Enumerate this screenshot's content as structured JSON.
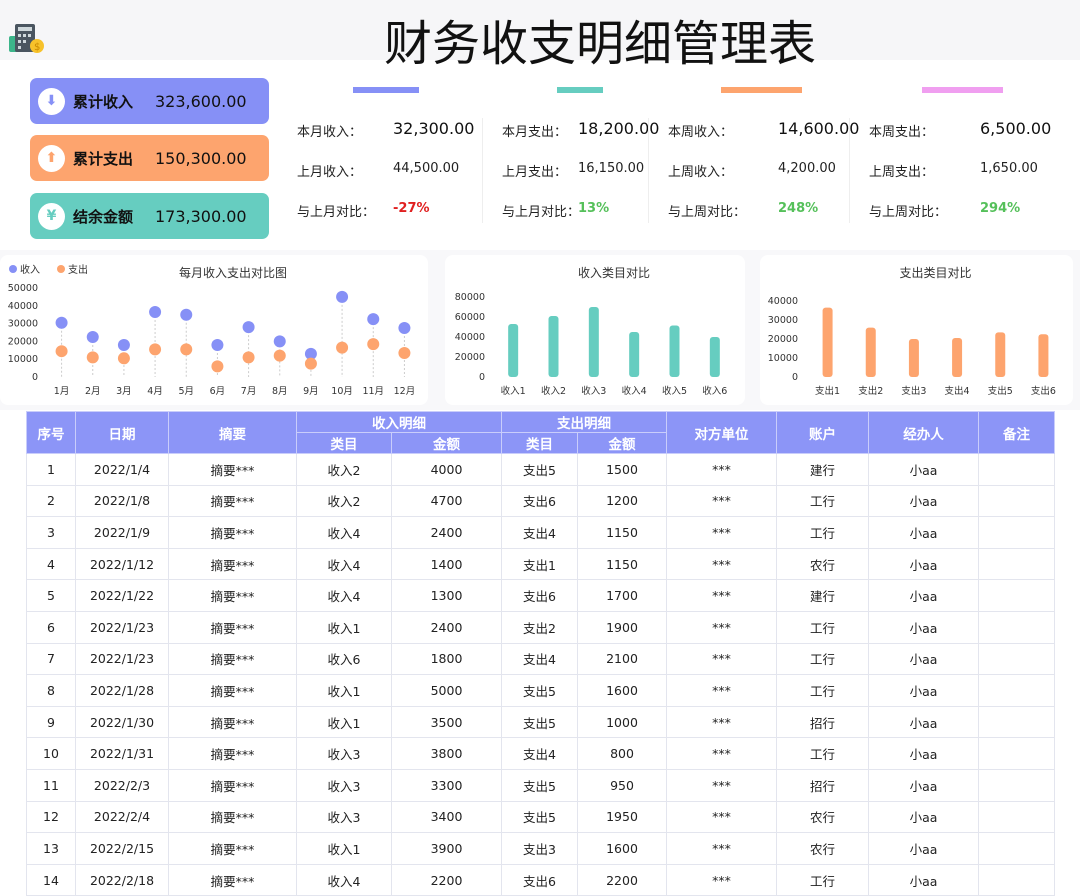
{
  "title": "财务收支明细管理表",
  "colors": {
    "income": "#8690f6",
    "expense": "#fda46e",
    "balance": "#66cdc0",
    "pink": "#f09ff0",
    "red": "#e02020",
    "green": "#55c05a",
    "header": "#8c95f7"
  },
  "cards": [
    {
      "label": "累计收入",
      "value": "323,600.00",
      "icon": "arrow-down-icon",
      "glyph": "⬇"
    },
    {
      "label": "累计支出",
      "value": "150,300.00",
      "icon": "arrow-up-icon",
      "glyph": "⬆"
    },
    {
      "label": "结余金额",
      "value": "173,300.00",
      "icon": "yuan-icon",
      "glyph": "¥"
    }
  ],
  "stats": [
    {
      "l1": "本月收入：",
      "v1": "32,300.00",
      "l2": "上月收入：",
      "v2": "44,500.00",
      "l3": "与上月对比：",
      "v3": "-27%",
      "trend": "down"
    },
    {
      "l1": "本月支出：",
      "v1": "18,200.00",
      "l2": "上月支出：",
      "v2": "16,150.00",
      "l3": "与上月对比：",
      "v3": "13%",
      "trend": "up"
    },
    {
      "l1": "本周收入：",
      "v1": "14,600.00",
      "l2": "上周收入：",
      "v2": "4,200.00",
      "l3": "与上周对比：",
      "v3": "248%",
      "trend": "up"
    },
    {
      "l1": "本周支出：",
      "v1": "6,500.00",
      "l2": "上周支出：",
      "v2": "1,650.00",
      "l3": "与上周对比：",
      "v3": "294%",
      "trend": "up"
    }
  ],
  "chart_data": [
    {
      "type": "scatter",
      "title": "每月收入支出对比图",
      "legend": [
        "收入",
        "支出"
      ],
      "legend_position": "top-left",
      "categories": [
        "1月",
        "2月",
        "3月",
        "4月",
        "5月",
        "6月",
        "7月",
        "8月",
        "9月",
        "10月",
        "11月",
        "12月"
      ],
      "yticks": [
        "0",
        "10000",
        "20000",
        "30000",
        "40000",
        "50000"
      ],
      "ylim": [
        0,
        50000
      ],
      "series": [
        {
          "name": "收入",
          "values": [
            30500,
            22500,
            18000,
            36500,
            35000,
            18000,
            28000,
            20000,
            13000,
            45000,
            32500,
            27500
          ]
        },
        {
          "name": "支出",
          "values": [
            14500,
            11000,
            10500,
            15500,
            15500,
            6000,
            11000,
            12000,
            7500,
            16500,
            18500,
            13500
          ]
        }
      ]
    },
    {
      "type": "bar",
      "title": "收入类目对比",
      "categories": [
        "收入1",
        "收入2",
        "收入3",
        "收入4",
        "收入5",
        "收入6"
      ],
      "values": [
        53000,
        61000,
        70000,
        45000,
        51500,
        40000
      ],
      "yticks": [
        "0",
        "20000",
        "40000",
        "60000",
        "80000"
      ],
      "ylim": [
        0,
        80000
      ]
    },
    {
      "type": "bar",
      "title": "支出类目对比",
      "categories": [
        "支出1",
        "支出2",
        "支出3",
        "支出4",
        "支出5",
        "支出6"
      ],
      "values": [
        36500,
        26000,
        20000,
        20500,
        23500,
        22500
      ],
      "yticks": [
        "0",
        "10000",
        "20000",
        "30000",
        "40000"
      ],
      "ylim": [
        0,
        40000
      ]
    }
  ],
  "table": {
    "headers": {
      "no": "序号",
      "date": "日期",
      "summary": "摘要",
      "income": "收入明细",
      "expense": "支出明细",
      "cat": "类目",
      "amt": "金额",
      "party": "对方单位",
      "account": "账户",
      "handler": "经办人",
      "note": "备注"
    },
    "rows": [
      [
        "1",
        "2022/1/4",
        "摘要***",
        "收入2",
        "4000",
        "支出5",
        "1500",
        "***",
        "建行",
        "小aa",
        ""
      ],
      [
        "2",
        "2022/1/8",
        "摘要***",
        "收入2",
        "4700",
        "支出6",
        "1200",
        "***",
        "工行",
        "小aa",
        ""
      ],
      [
        "3",
        "2022/1/9",
        "摘要***",
        "收入4",
        "2400",
        "支出4",
        "1150",
        "***",
        "工行",
        "小aa",
        ""
      ],
      [
        "4",
        "2022/1/12",
        "摘要***",
        "收入4",
        "1400",
        "支出1",
        "1150",
        "***",
        "农行",
        "小aa",
        ""
      ],
      [
        "5",
        "2022/1/22",
        "摘要***",
        "收入4",
        "1300",
        "支出6",
        "1700",
        "***",
        "建行",
        "小aa",
        ""
      ],
      [
        "6",
        "2022/1/23",
        "摘要***",
        "收入1",
        "2400",
        "支出2",
        "1900",
        "***",
        "工行",
        "小aa",
        ""
      ],
      [
        "7",
        "2022/1/23",
        "摘要***",
        "收入6",
        "1800",
        "支出4",
        "2100",
        "***",
        "工行",
        "小aa",
        ""
      ],
      [
        "8",
        "2022/1/28",
        "摘要***",
        "收入1",
        "5000",
        "支出5",
        "1600",
        "***",
        "工行",
        "小aa",
        ""
      ],
      [
        "9",
        "2022/1/30",
        "摘要***",
        "收入1",
        "3500",
        "支出5",
        "1000",
        "***",
        "招行",
        "小aa",
        ""
      ],
      [
        "10",
        "2022/1/31",
        "摘要***",
        "收入3",
        "3800",
        "支出4",
        "800",
        "***",
        "工行",
        "小aa",
        ""
      ],
      [
        "11",
        "2022/2/3",
        "摘要***",
        "收入3",
        "3300",
        "支出5",
        "950",
        "***",
        "招行",
        "小aa",
        ""
      ],
      [
        "12",
        "2022/2/4",
        "摘要***",
        "收入3",
        "3400",
        "支出5",
        "1950",
        "***",
        "农行",
        "小aa",
        ""
      ],
      [
        "13",
        "2022/2/15",
        "摘要***",
        "收入1",
        "3900",
        "支出3",
        "1600",
        "***",
        "农行",
        "小aa",
        ""
      ],
      [
        "14",
        "2022/2/18",
        "摘要***",
        "收入4",
        "2200",
        "支出6",
        "2200",
        "***",
        "工行",
        "小aa",
        ""
      ]
    ]
  }
}
